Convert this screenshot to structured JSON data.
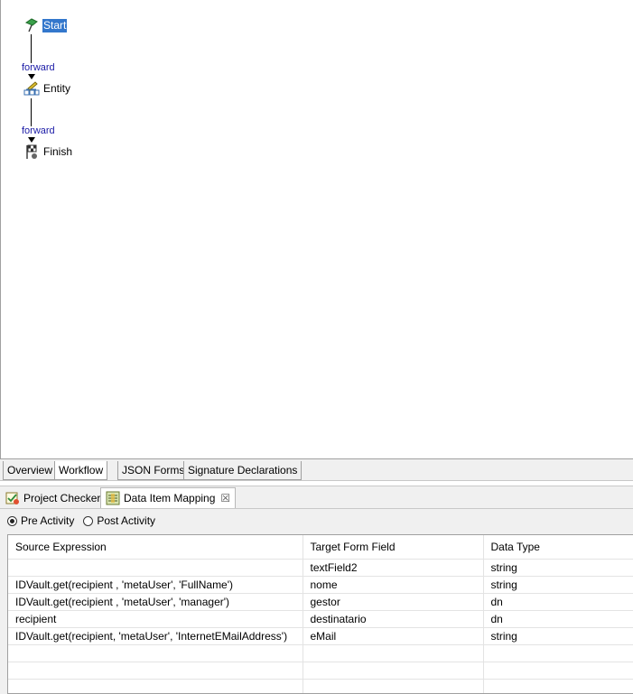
{
  "workflow": {
    "nodes": [
      {
        "label": "Start",
        "icon": "start-flag-icon",
        "selected": true
      },
      {
        "label": "Entity",
        "icon": "entity-icon",
        "selected": false
      },
      {
        "label": "Finish",
        "icon": "finish-flag-icon",
        "selected": false
      }
    ],
    "flows": [
      "forward",
      "forward"
    ]
  },
  "editor_tabs": [
    "Overview",
    "Workflow",
    "JSON Forms",
    "Signature Declarations"
  ],
  "views": {
    "project_checker": "Project Checker",
    "data_item_mapping": "Data Item Mapping"
  },
  "activity_options": {
    "pre": "Pre Activity",
    "post": "Post Activity",
    "selected": "pre"
  },
  "table": {
    "headers": [
      "Source Expression",
      "Target Form Field",
      "Data Type"
    ],
    "rows": [
      [
        "",
        "textField2",
        "string"
      ],
      [
        "IDVault.get(recipient , 'metaUser', 'FullName')",
        "nome",
        "string"
      ],
      [
        "IDVault.get(recipient , 'metaUser', 'manager')",
        "gestor",
        "dn"
      ],
      [
        "recipient",
        "destinatario",
        "dn"
      ],
      [
        "IDVault.get(recipient, 'metaUser', 'InternetEMailAddress')",
        "eMail",
        "string"
      ],
      [
        "",
        "",
        ""
      ],
      [
        "",
        "",
        ""
      ],
      [
        "",
        "",
        ""
      ]
    ]
  }
}
